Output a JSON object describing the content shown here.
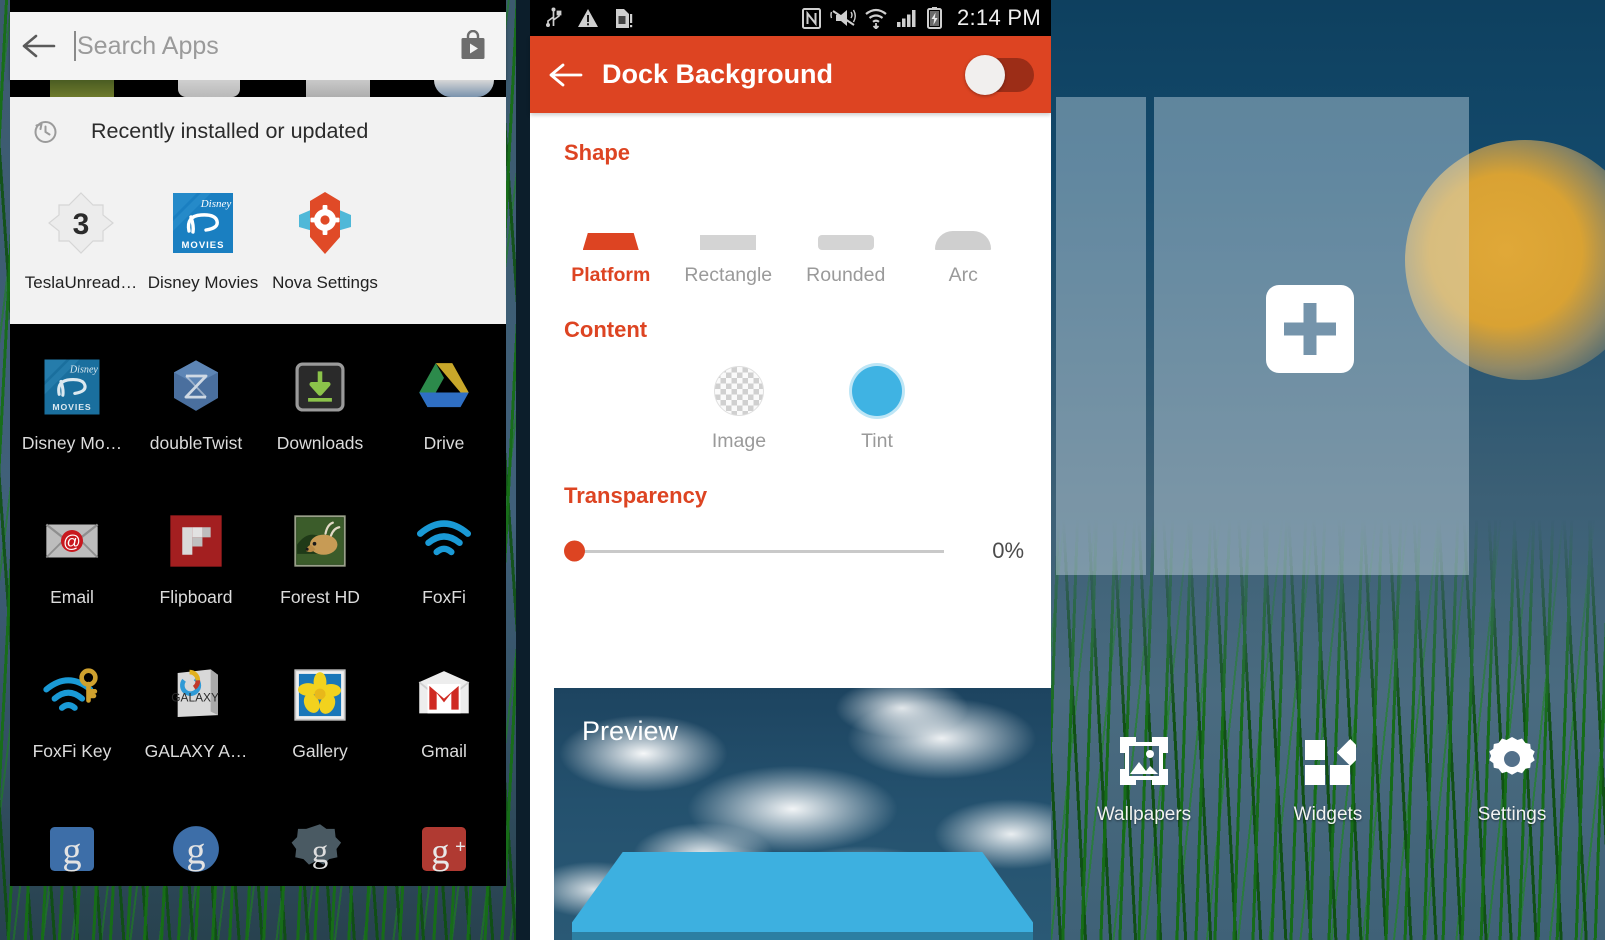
{
  "app_drawer": {
    "search": {
      "placeholder": "Search Apps",
      "value": "",
      "back_icon": "back-arrow-icon",
      "store_icon": "play-store-bag-icon"
    },
    "recent_section": {
      "icon": "history-clock-icon",
      "title": "Recently installed or updated",
      "apps": [
        {
          "label": "TeslaUnread…",
          "icon": "teslaunread-icon",
          "badge": "3"
        },
        {
          "label": "Disney Movies",
          "icon": "disney-movies-icon"
        },
        {
          "label": "Nova Settings",
          "icon": "nova-settings-icon"
        }
      ]
    },
    "grid": [
      [
        {
          "label": "Disney Mo…",
          "icon": "disney-movies-icon"
        },
        {
          "label": "doubleTwist",
          "icon": "doubletwist-icon"
        },
        {
          "label": "Downloads",
          "icon": "downloads-icon"
        },
        {
          "label": "Drive",
          "icon": "google-drive-icon"
        }
      ],
      [
        {
          "label": "Email",
          "icon": "email-icon"
        },
        {
          "label": "Flipboard",
          "icon": "flipboard-icon"
        },
        {
          "label": "Forest HD",
          "icon": "forest-hd-icon"
        },
        {
          "label": "FoxFi",
          "icon": "foxfi-wifi-icon"
        }
      ],
      [
        {
          "label": "FoxFi Key",
          "icon": "foxfi-key-icon"
        },
        {
          "label": "GALAXY A…",
          "icon": "galaxy-apps-icon"
        },
        {
          "label": "Gallery",
          "icon": "gallery-flower-icon"
        },
        {
          "label": "Gmail",
          "icon": "gmail-icon"
        }
      ],
      [
        {
          "label": "",
          "icon": "google-blue-square-icon"
        },
        {
          "label": "",
          "icon": "google-blue-circle-icon"
        },
        {
          "label": "",
          "icon": "google-settings-gear-icon"
        },
        {
          "label": "",
          "icon": "google-plus-icon"
        }
      ]
    ]
  },
  "nova_settings": {
    "status_bar": {
      "left_icons": [
        "usb-icon",
        "warning-triangle-icon",
        "sim-card-alert-icon"
      ],
      "right_icons": [
        "nfc-icon",
        "vibrate-mute-icon",
        "wifi-icon",
        "cell-signal-icon",
        "battery-charging-icon"
      ],
      "clock": "2:14 PM"
    },
    "app_bar": {
      "back_icon": "back-arrow-icon",
      "title": "Dock Background",
      "toggle": {
        "name": "dock-background-toggle",
        "state": "off"
      }
    },
    "shape": {
      "title": "Shape",
      "selected": "Platform",
      "options": [
        {
          "label": "Platform",
          "icon": "shape-platform-icon"
        },
        {
          "label": "Rectangle",
          "icon": "shape-rectangle-icon"
        },
        {
          "label": "Rounded",
          "icon": "shape-rounded-icon"
        },
        {
          "label": "Arc",
          "icon": "shape-arc-icon"
        }
      ]
    },
    "content": {
      "title": "Content",
      "selected": "Tint",
      "tint_color": "#3fb3e3",
      "options": [
        {
          "label": "Image",
          "icon": "checkerboard-image-icon"
        },
        {
          "label": "Tint",
          "icon": "tint-color-swatch-icon"
        }
      ]
    },
    "transparency": {
      "title": "Transparency",
      "value": "0%",
      "percent": 0
    },
    "preview": {
      "label": "Preview",
      "dock_color": "#3db0e0"
    },
    "accent_color": "#dd4422"
  },
  "homescreen": {
    "add_icon": "add-plus-icon",
    "actions": [
      {
        "label": "Wallpapers",
        "icon": "wallpapers-image-icon"
      },
      {
        "label": "Widgets",
        "icon": "widgets-shapes-icon"
      },
      {
        "label": "Settings",
        "icon": "settings-gear-icon"
      }
    ]
  }
}
